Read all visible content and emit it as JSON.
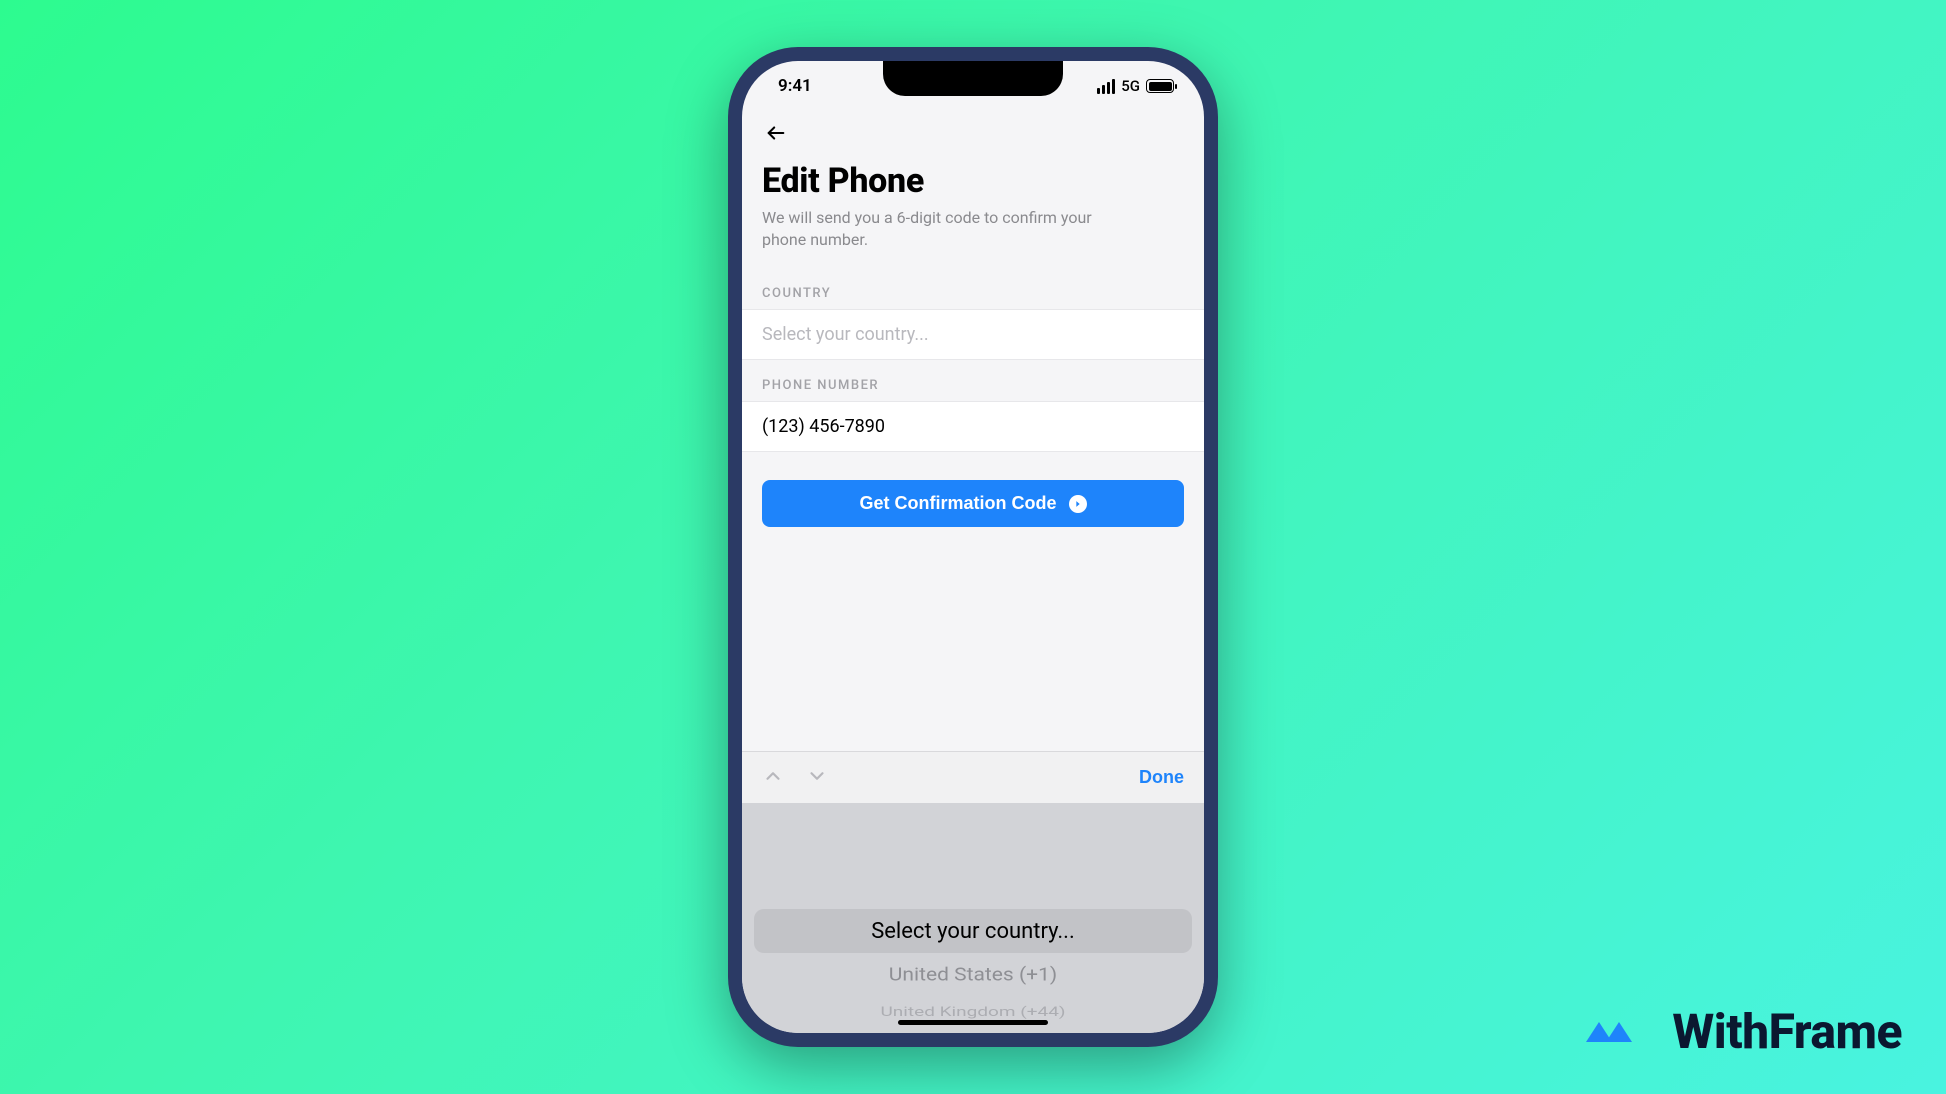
{
  "status_bar": {
    "time": "9:41",
    "network_type": "5G"
  },
  "header": {
    "title": "Edit Phone",
    "subtitle": "We will send you a 6-digit code to confirm your phone number."
  },
  "form": {
    "country_label": "COUNTRY",
    "country_placeholder": "Select your country...",
    "phone_label": "PHONE NUMBER",
    "phone_value": "(123) 456-7890"
  },
  "cta": {
    "label": "Get Confirmation Code"
  },
  "accessory": {
    "done_label": "Done"
  },
  "picker": {
    "options": [
      "Select your country...",
      "United States (+1)",
      "United Kingdom (+44)"
    ]
  },
  "brand": {
    "name": "WithFrame"
  }
}
